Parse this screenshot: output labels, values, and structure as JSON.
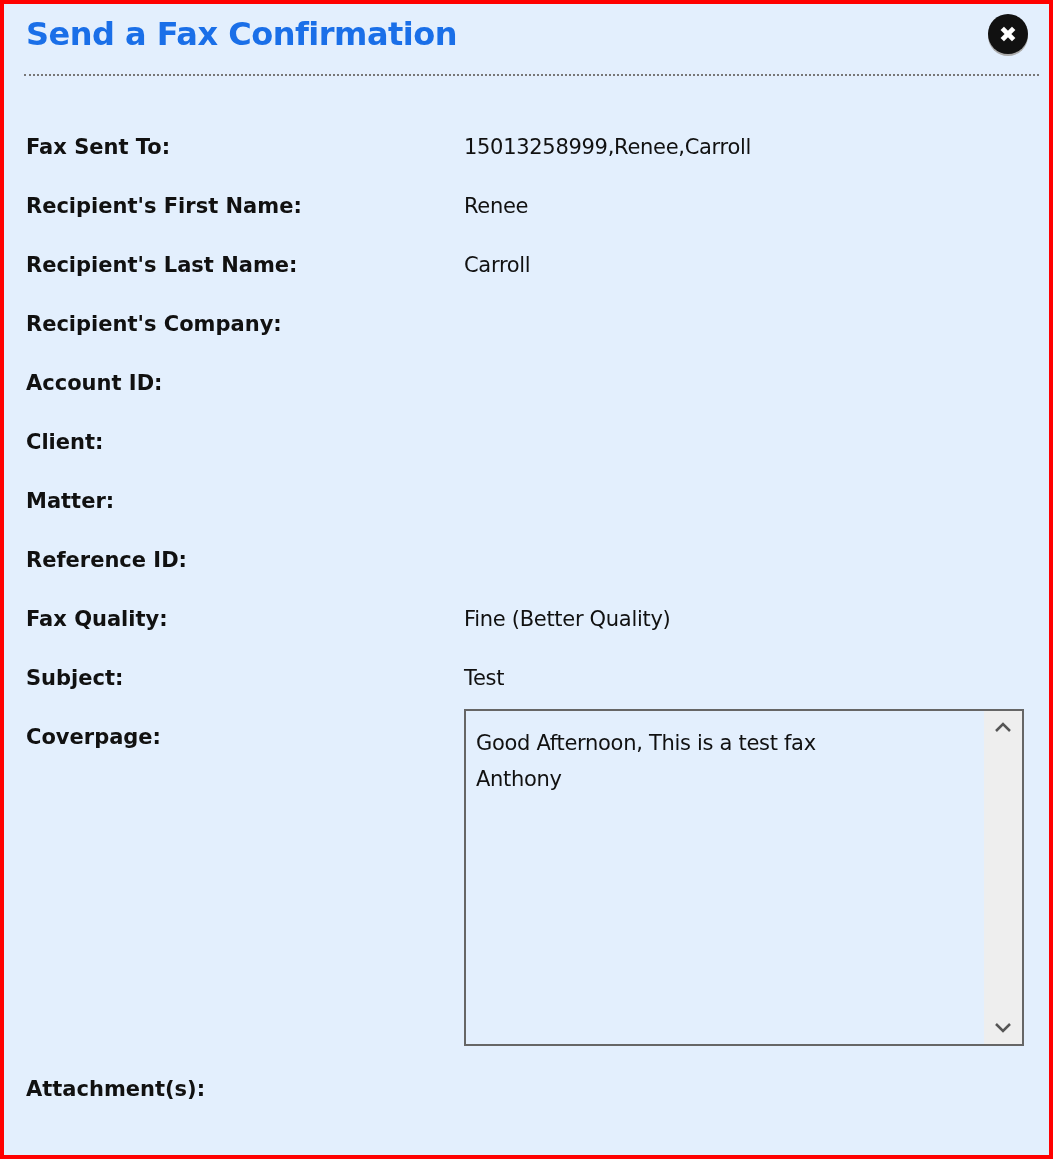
{
  "dialog": {
    "title": "Send a Fax Confirmation",
    "close_button": "✖"
  },
  "fields": [
    {
      "kind": "text",
      "label": "Fax Sent To:",
      "value": "15013258999,Renee,Carroll"
    },
    {
      "kind": "text",
      "label": "Recipient's First Name:",
      "value": "Renee"
    },
    {
      "kind": "text",
      "label": "Recipient's Last Name:",
      "value": "Carroll"
    },
    {
      "kind": "text",
      "label": "Recipient's Company:"
    },
    {
      "kind": "text",
      "label": "Account ID:"
    },
    {
      "kind": "text",
      "label": "Client:"
    },
    {
      "kind": "text",
      "label": "Matter:"
    },
    {
      "kind": "text",
      "label": "Reference ID:"
    },
    {
      "kind": "text",
      "label": "Fax Quality:",
      "value": "Fine (Better Quality)"
    },
    {
      "kind": "text",
      "label": "Subject:",
      "value": "Test"
    },
    {
      "kind": "textarea",
      "label": "Coverpage:",
      "value": "Good Afternoon, This is a test fax\nAnthony"
    },
    {
      "kind": "text",
      "label": "Attachment(s):"
    }
  ]
}
